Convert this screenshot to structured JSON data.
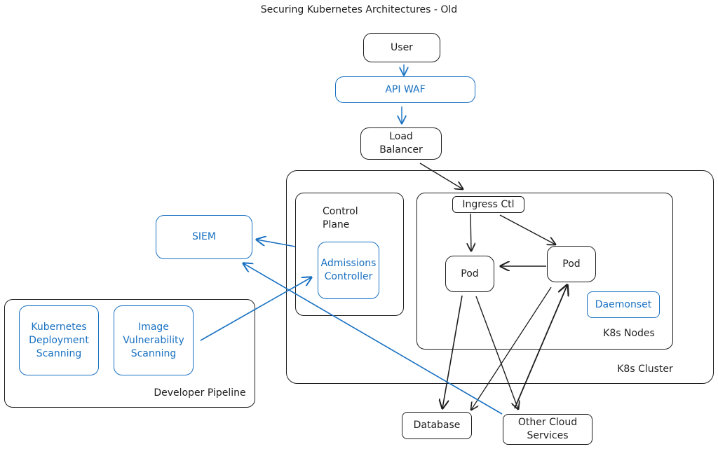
{
  "title": "Securing Kubernetes Architectures - Old",
  "colors": {
    "ink": "#1e1e1e",
    "accent": "#1971c2",
    "background": "#ffffff"
  },
  "nodes": {
    "user": "User",
    "api_waf": "API WAF",
    "load_balancer": "Load\nBalancer",
    "siem": "SIEM",
    "control_plane": "Control\nPlane",
    "admissions_controller": "Admissions\nController",
    "ingress_ctl": "Ingress Ctl",
    "pod_left": "Pod",
    "pod_right": "Pod",
    "daemonset": "Daemonset",
    "kubernetes_deployment_scanning": "Kubernetes\nDeployment\nScanning",
    "image_vulnerability_scanning": "Image\nVulnerability\nScanning",
    "database": "Database",
    "other_cloud_services": "Other Cloud\nServices"
  },
  "groups": {
    "k8s_nodes": "K8s Nodes",
    "k8s_cluster": "K8s Cluster",
    "developer_pipeline": "Developer Pipeline"
  },
  "edges": [
    {
      "from": "User",
      "to": "API WAF",
      "color": "accent"
    },
    {
      "from": "API WAF",
      "to": "Load Balancer",
      "color": "accent"
    },
    {
      "from": "Load Balancer",
      "to": "K8s Nodes",
      "color": "ink"
    },
    {
      "from": "Ingress Ctl",
      "to": "Pod (left)",
      "color": "ink"
    },
    {
      "from": "Ingress Ctl",
      "to": "Pod (right)",
      "color": "ink"
    },
    {
      "from": "Pod (right)",
      "to": "Pod (left)",
      "color": "ink"
    },
    {
      "from": "Pod (left)",
      "to": "Database",
      "color": "ink"
    },
    {
      "from": "Pod (left)",
      "to": "Other Cloud Services",
      "color": "ink"
    },
    {
      "from": "Pod (right)",
      "to": "Database",
      "color": "ink"
    },
    {
      "from": "Other Cloud Services",
      "to": "Pod (right)",
      "color": "ink"
    },
    {
      "from": "Control Plane",
      "to": "SIEM",
      "color": "accent"
    },
    {
      "from": "Other Cloud Services",
      "to": "SIEM",
      "color": "accent"
    },
    {
      "from": "Image Vulnerability Scanning",
      "to": "Admissions Controller",
      "color": "accent"
    }
  ]
}
